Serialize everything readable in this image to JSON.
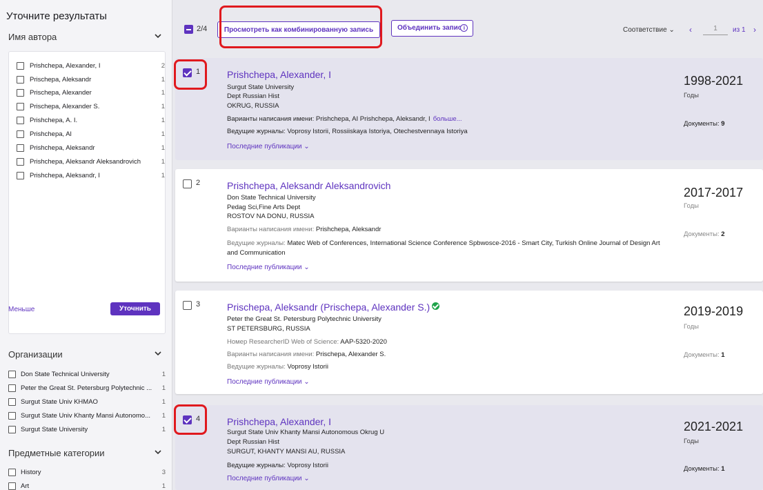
{
  "sidebar": {
    "title": "Уточните результаты",
    "author_section": "Имя автора",
    "authors": [
      {
        "name": "Prishchepa, Alexander, I",
        "count": "2"
      },
      {
        "name": "Prischepa, Aleksandr",
        "count": "1"
      },
      {
        "name": "Prischepa, Alexander",
        "count": "1"
      },
      {
        "name": "Prischepa, Alexander S.",
        "count": "1"
      },
      {
        "name": "Prishchepa, A. I.",
        "count": "1"
      },
      {
        "name": "Prishchepa, Al",
        "count": "1"
      },
      {
        "name": "Prishchepa, Aleksandr",
        "count": "1"
      },
      {
        "name": "Prishchepa, Aleksandr Aleksandrovich",
        "count": "1"
      },
      {
        "name": "Prishchepa, Aleksandr, I",
        "count": "1"
      }
    ],
    "less_label": "Меньше",
    "refine_label": "Уточнить",
    "org_section": "Организации",
    "orgs": [
      {
        "name": "Don State Technical University",
        "count": "1"
      },
      {
        "name": "Peter the Great St. Petersburg Polytechnic ...",
        "count": "1"
      },
      {
        "name": "Surgut State Univ KHMAO",
        "count": "1"
      },
      {
        "name": "Surgut State Univ Khanty Mansi Autonomo...",
        "count": "1"
      },
      {
        "name": "Surgut State University",
        "count": "1"
      }
    ],
    "subject_section": "Предметные категории",
    "subjects": [
      {
        "name": "History",
        "count": "3"
      },
      {
        "name": "Art",
        "count": "1"
      }
    ]
  },
  "toolbar": {
    "selected_count": "2/4",
    "combined_label": "Просмотреть как комбинированную запись",
    "merge_label": "Объединить запис",
    "info_glyph": "i",
    "sort_label": "Соответствие",
    "page_value": "1",
    "page_of": "из 1",
    "prev_glyph": "‹",
    "next_glyph": "›"
  },
  "results": [
    {
      "num": "1",
      "name": "Prishchepa, Alexander, I",
      "aff1": "Surgut State University",
      "aff2": "Dept Russian Hist",
      "aff3": "OKRUG, RUSSIA",
      "variants_label": "Варианты написания имени:",
      "variants": "Prishchepa, AI   Prishchepa, Aleksandr, I",
      "more_label": "больше...",
      "journals_label": "Ведущие журналы:",
      "journals": "Voprosy Istorii, Rossiiskaya Istoriya, Otechestvennaya Istoriya",
      "recent_label": "Последние публикации ⌄",
      "years": "1998-2021",
      "years_label": "Годы",
      "docs_label": "Документы:",
      "docs": "9"
    },
    {
      "num": "2",
      "name": "Prishchepa, Aleksandr Aleksandrovich",
      "aff1": "Don State Technical University",
      "aff2": "Pedag Sci,Fine Arts Dept",
      "aff3": "ROSTOV NA DONU, RUSSIA",
      "variants_label": "Варианты написания имени:",
      "variants": "Prishchepa, Aleksandr",
      "journals_label": "Ведущие журналы:",
      "journals": "Matec Web of Conferences, International Science Conference Spbwosce-2016 - Smart City, Turkish Online Journal of Design Art",
      "journals2": "and Communication",
      "recent_label": "Последние публикации ⌄",
      "years": "2017-2017",
      "years_label": "Годы",
      "docs_label": "Документы:",
      "docs": "2"
    },
    {
      "num": "3",
      "name": "Prischepa, Aleksandr (Prischepa, Alexander S.)",
      "aff1": "Peter the Great St. Petersburg Polytechnic University",
      "aff2": "ST PETERSBURG, RUSSIA",
      "rid_label": "Номер ResearcherID Web of Science:",
      "rid": "AAP-5320-2020",
      "variants_label": "Варианты написания имени:",
      "variants": "Prischepa, Alexander S.",
      "journals_label": "Ведущие журналы:",
      "journals": "Voprosy Istorii",
      "recent_label": "Последние публикации ⌄",
      "years": "2019-2019",
      "years_label": "Годы",
      "docs_label": "Документы:",
      "docs": "1"
    },
    {
      "num": "4",
      "name": "Prishchepa, Alexander, I",
      "aff1": "Surgut State Univ Khanty Mansi Autonomous Okrug U",
      "aff2": "Dept Russian Hist",
      "aff3": "SURGUT, KHANTY MANSI AU, RUSSIA",
      "journals_label": "Ведущие журналы:",
      "journals": "Voprosy Istorii",
      "recent_label": "Последние публикации ⌄",
      "years": "2021-2021",
      "years_label": "Годы",
      "docs_label": "Документы:",
      "docs": "1"
    }
  ],
  "colors": {
    "accent": "#5e33bf",
    "selected_card": "#e4e3ee",
    "highlight": "#e0191e",
    "verified": "#1fa34a"
  }
}
